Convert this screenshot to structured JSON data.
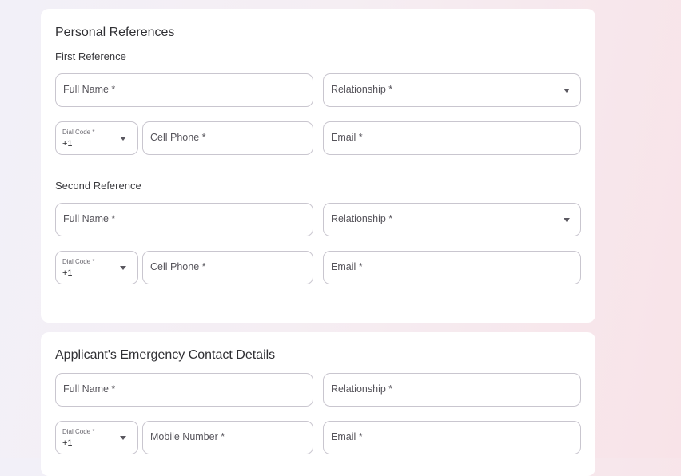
{
  "personal_references": {
    "title": "Personal References",
    "first": {
      "subtitle": "First Reference",
      "full_name_placeholder": "Full Name *",
      "relationship_placeholder": "Relationship *",
      "dial_code_label": "Dial Code *",
      "dial_code_value": "+1",
      "cell_phone_placeholder": "Cell Phone *",
      "email_placeholder": "Email *"
    },
    "second": {
      "subtitle": "Second Reference",
      "full_name_placeholder": "Full Name *",
      "relationship_placeholder": "Relationship *",
      "dial_code_label": "Dial Code *",
      "dial_code_value": "+1",
      "cell_phone_placeholder": "Cell Phone *",
      "email_placeholder": "Email *"
    }
  },
  "emergency_contact": {
    "title": "Applicant's Emergency Contact Details",
    "full_name_placeholder": "Full Name *",
    "relationship_placeholder": "Relationship *",
    "dial_code_label": "Dial Code *",
    "dial_code_value": "+1",
    "mobile_number_placeholder": "Mobile Number *",
    "email_placeholder": "Email *"
  },
  "colors": {
    "card_background": "#ffffff",
    "field_border": "#c9c6cf",
    "page_gradient_left": "#f2f0f8",
    "page_gradient_right": "#f8e3e8"
  },
  "icons": {
    "select_caret": "caret-down-icon"
  }
}
